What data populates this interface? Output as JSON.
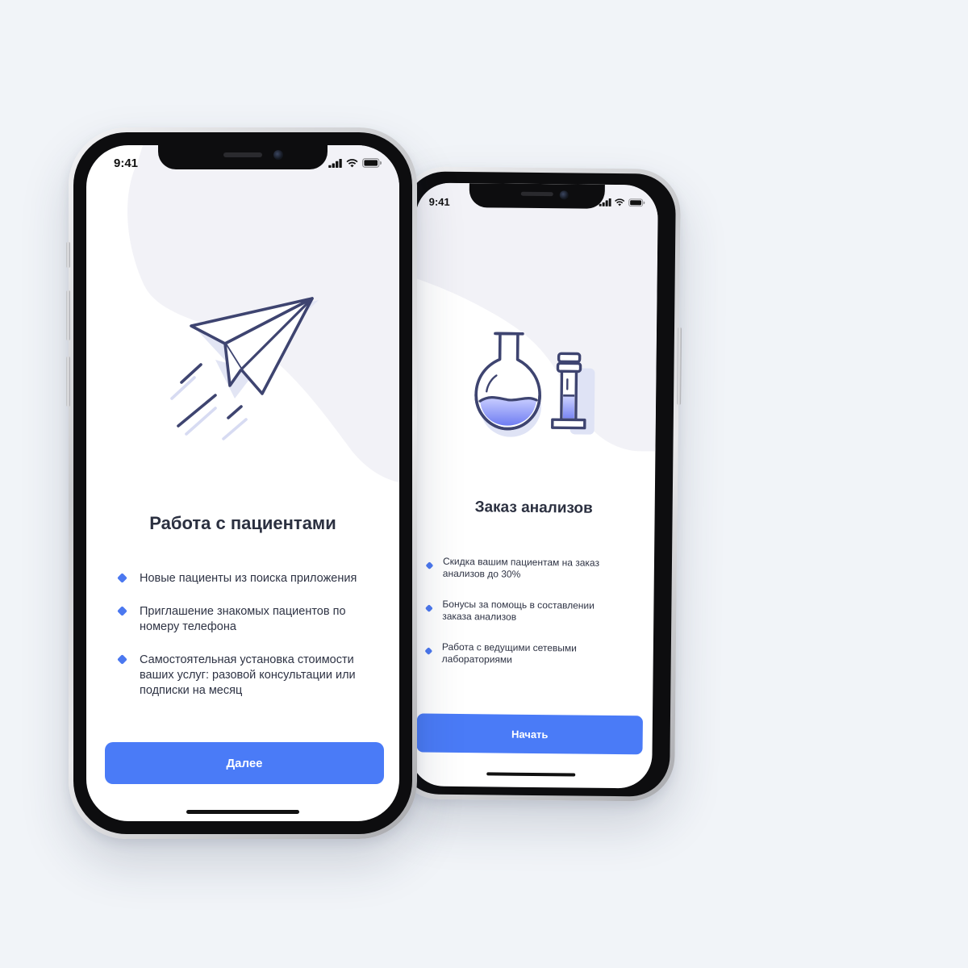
{
  "colors": {
    "background": "#f1f4f8",
    "accent": "#4a7bf7",
    "bullet": "#4b78f0",
    "title_text": "#2b3040",
    "illustration_stroke": "#3e4470",
    "blob": "#f2f2f7"
  },
  "left_phone": {
    "status": {
      "time": "9:41",
      "icons": [
        "signal-icon",
        "wifi-icon",
        "battery-icon"
      ]
    },
    "illustration": "paper-plane-icon",
    "title": "Работа с пациентами",
    "bullets": [
      "Новые пациенты из поиска приложения",
      "Приглашение знакомых пациентов по номеру телефона",
      "Самостоятельная установка стоимости ваших услуг: разовой консультации или подписки на месяц"
    ],
    "button_label": "Далее"
  },
  "right_phone": {
    "status": {
      "time": "9:41",
      "icons": [
        "signal-icon",
        "wifi-icon",
        "battery-icon"
      ]
    },
    "illustration": "lab-flask-icon",
    "title": "Заказ анализов",
    "bullets": [
      "Скидка вашим пациентам на заказ анализов до 30%",
      "Бонусы за помощь в составлении заказа анализов",
      "Работа с ведущими сетевыми лабораториями"
    ],
    "button_label": "Начать"
  }
}
